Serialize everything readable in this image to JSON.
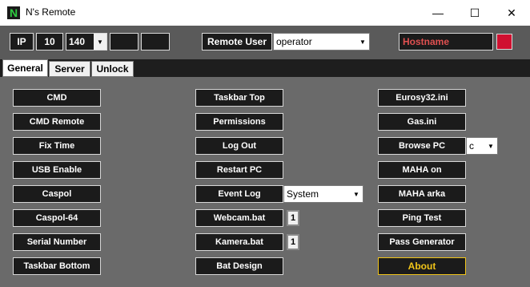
{
  "window": {
    "title": "N's Remote",
    "icon_letter": "N",
    "minimize_glyph": "—",
    "maximize_glyph": "☐",
    "close_glyph": "✕"
  },
  "topbar": {
    "ip_label": "IP",
    "ip_octet_3": "10",
    "ip_octet_4": "140",
    "remote_user_label": "Remote User",
    "remote_user_value": "operator",
    "hostname_placeholder": "Hostname",
    "status_color": "#d01030"
  },
  "tabs": [
    {
      "label": "General"
    },
    {
      "label": "Server"
    },
    {
      "label": "Unlock"
    }
  ],
  "general": {
    "col1": [
      "CMD",
      "CMD Remote",
      "Fix Time",
      "USB Enable",
      "Caspol",
      "Caspol-64",
      "Serial Number",
      "Taskbar Bottom"
    ],
    "col2": [
      "Taskbar Top",
      "Permissions",
      "Log Out",
      "Restart PC",
      "Event Log",
      "Webcam.bat",
      "Kamera.bat",
      "Bat Design"
    ],
    "col3": [
      "Eurosy32.ini",
      "Gas.ini",
      "Browse PC",
      "MAHA on",
      "MAHA arka",
      "Ping Test",
      "Pass Generator",
      "About"
    ],
    "event_log_value": "System",
    "webcam_count": "1",
    "kamera_count": "1",
    "browse_drive": "c"
  }
}
